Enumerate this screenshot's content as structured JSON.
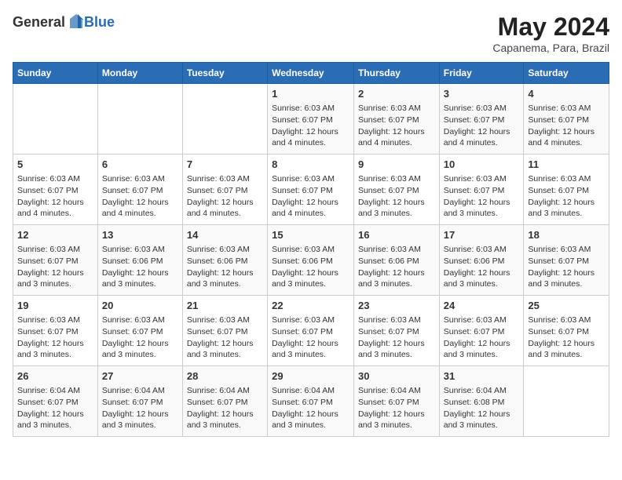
{
  "header": {
    "logo_general": "General",
    "logo_blue": "Blue",
    "month": "May 2024",
    "location": "Capanema, Para, Brazil"
  },
  "days_of_week": [
    "Sunday",
    "Monday",
    "Tuesday",
    "Wednesday",
    "Thursday",
    "Friday",
    "Saturday"
  ],
  "weeks": [
    [
      {
        "day": "",
        "content": ""
      },
      {
        "day": "",
        "content": ""
      },
      {
        "day": "",
        "content": ""
      },
      {
        "day": "1",
        "content": "Sunrise: 6:03 AM\nSunset: 6:07 PM\nDaylight: 12 hours\nand 4 minutes."
      },
      {
        "day": "2",
        "content": "Sunrise: 6:03 AM\nSunset: 6:07 PM\nDaylight: 12 hours\nand 4 minutes."
      },
      {
        "day": "3",
        "content": "Sunrise: 6:03 AM\nSunset: 6:07 PM\nDaylight: 12 hours\nand 4 minutes."
      },
      {
        "day": "4",
        "content": "Sunrise: 6:03 AM\nSunset: 6:07 PM\nDaylight: 12 hours\nand 4 minutes."
      }
    ],
    [
      {
        "day": "5",
        "content": "Sunrise: 6:03 AM\nSunset: 6:07 PM\nDaylight: 12 hours\nand 4 minutes."
      },
      {
        "day": "6",
        "content": "Sunrise: 6:03 AM\nSunset: 6:07 PM\nDaylight: 12 hours\nand 4 minutes."
      },
      {
        "day": "7",
        "content": "Sunrise: 6:03 AM\nSunset: 6:07 PM\nDaylight: 12 hours\nand 4 minutes."
      },
      {
        "day": "8",
        "content": "Sunrise: 6:03 AM\nSunset: 6:07 PM\nDaylight: 12 hours\nand 4 minutes."
      },
      {
        "day": "9",
        "content": "Sunrise: 6:03 AM\nSunset: 6:07 PM\nDaylight: 12 hours\nand 3 minutes."
      },
      {
        "day": "10",
        "content": "Sunrise: 6:03 AM\nSunset: 6:07 PM\nDaylight: 12 hours\nand 3 minutes."
      },
      {
        "day": "11",
        "content": "Sunrise: 6:03 AM\nSunset: 6:07 PM\nDaylight: 12 hours\nand 3 minutes."
      }
    ],
    [
      {
        "day": "12",
        "content": "Sunrise: 6:03 AM\nSunset: 6:07 PM\nDaylight: 12 hours\nand 3 minutes."
      },
      {
        "day": "13",
        "content": "Sunrise: 6:03 AM\nSunset: 6:06 PM\nDaylight: 12 hours\nand 3 minutes."
      },
      {
        "day": "14",
        "content": "Sunrise: 6:03 AM\nSunset: 6:06 PM\nDaylight: 12 hours\nand 3 minutes."
      },
      {
        "day": "15",
        "content": "Sunrise: 6:03 AM\nSunset: 6:06 PM\nDaylight: 12 hours\nand 3 minutes."
      },
      {
        "day": "16",
        "content": "Sunrise: 6:03 AM\nSunset: 6:06 PM\nDaylight: 12 hours\nand 3 minutes."
      },
      {
        "day": "17",
        "content": "Sunrise: 6:03 AM\nSunset: 6:06 PM\nDaylight: 12 hours\nand 3 minutes."
      },
      {
        "day": "18",
        "content": "Sunrise: 6:03 AM\nSunset: 6:07 PM\nDaylight: 12 hours\nand 3 minutes."
      }
    ],
    [
      {
        "day": "19",
        "content": "Sunrise: 6:03 AM\nSunset: 6:07 PM\nDaylight: 12 hours\nand 3 minutes."
      },
      {
        "day": "20",
        "content": "Sunrise: 6:03 AM\nSunset: 6:07 PM\nDaylight: 12 hours\nand 3 minutes."
      },
      {
        "day": "21",
        "content": "Sunrise: 6:03 AM\nSunset: 6:07 PM\nDaylight: 12 hours\nand 3 minutes."
      },
      {
        "day": "22",
        "content": "Sunrise: 6:03 AM\nSunset: 6:07 PM\nDaylight: 12 hours\nand 3 minutes."
      },
      {
        "day": "23",
        "content": "Sunrise: 6:03 AM\nSunset: 6:07 PM\nDaylight: 12 hours\nand 3 minutes."
      },
      {
        "day": "24",
        "content": "Sunrise: 6:03 AM\nSunset: 6:07 PM\nDaylight: 12 hours\nand 3 minutes."
      },
      {
        "day": "25",
        "content": "Sunrise: 6:03 AM\nSunset: 6:07 PM\nDaylight: 12 hours\nand 3 minutes."
      }
    ],
    [
      {
        "day": "26",
        "content": "Sunrise: 6:04 AM\nSunset: 6:07 PM\nDaylight: 12 hours\nand 3 minutes."
      },
      {
        "day": "27",
        "content": "Sunrise: 6:04 AM\nSunset: 6:07 PM\nDaylight: 12 hours\nand 3 minutes."
      },
      {
        "day": "28",
        "content": "Sunrise: 6:04 AM\nSunset: 6:07 PM\nDaylight: 12 hours\nand 3 minutes."
      },
      {
        "day": "29",
        "content": "Sunrise: 6:04 AM\nSunset: 6:07 PM\nDaylight: 12 hours\nand 3 minutes."
      },
      {
        "day": "30",
        "content": "Sunrise: 6:04 AM\nSunset: 6:07 PM\nDaylight: 12 hours\nand 3 minutes."
      },
      {
        "day": "31",
        "content": "Sunrise: 6:04 AM\nSunset: 6:08 PM\nDaylight: 12 hours\nand 3 minutes."
      },
      {
        "day": "",
        "content": ""
      }
    ]
  ]
}
